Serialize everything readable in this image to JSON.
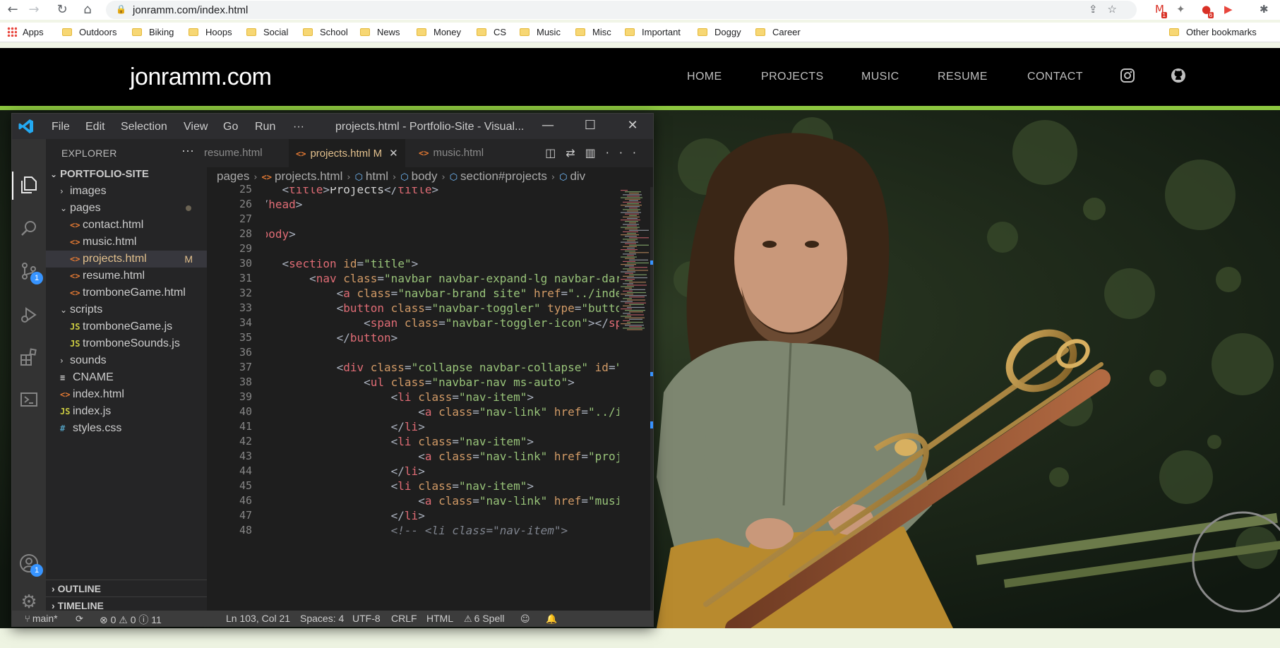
{
  "browser": {
    "url": "jonramm.com/index.html",
    "extensions": [
      {
        "name": "gmail-icon",
        "glyph": "M",
        "color": "#d93025",
        "badge": "1"
      },
      {
        "name": "dropbox-icon",
        "glyph": "✦",
        "color": "#7a7a7a",
        "badge": ""
      },
      {
        "name": "adblock-icon",
        "glyph": "●",
        "color": "#d93025",
        "badge": "6"
      },
      {
        "name": "cast-icon",
        "glyph": "▶",
        "color": "#e8453c",
        "badge": ""
      },
      {
        "name": "extension-bug-icon",
        "glyph": "✱",
        "color": "#5f6368",
        "badge": ""
      }
    ],
    "bookmarks": [
      "Apps",
      "Outdoors",
      "Biking",
      "Hoops",
      "Social",
      "School",
      "News",
      "Money",
      "CS",
      "Music",
      "Misc",
      "Important",
      "Doggy",
      "Career"
    ],
    "other_bookmarks": "Other bookmarks"
  },
  "site": {
    "brand": "jonramm.com",
    "nav": [
      "HOME",
      "PROJECTS",
      "MUSIC",
      "RESUME",
      "CONTACT"
    ],
    "accent": "#8cc63f"
  },
  "vscode": {
    "menu": [
      "File",
      "Edit",
      "Selection",
      "View",
      "Go",
      "Run",
      "···"
    ],
    "window_title": "projects.html - Portfolio-Site - Visual...",
    "explorer_title": "EXPLORER",
    "folder": "PORTFOLIO-SITE",
    "tree": [
      {
        "label": "images",
        "type": "folder",
        "open": false,
        "depth": 1
      },
      {
        "label": "pages",
        "type": "folder",
        "open": true,
        "depth": 1,
        "dot": true
      },
      {
        "label": "contact.html",
        "type": "html",
        "depth": 2
      },
      {
        "label": "music.html",
        "type": "html",
        "depth": 2
      },
      {
        "label": "projects.html",
        "type": "html",
        "depth": 2,
        "selected": true,
        "status": "M"
      },
      {
        "label": "resume.html",
        "type": "html",
        "depth": 2
      },
      {
        "label": "tromboneGame.html",
        "type": "html",
        "depth": 2
      },
      {
        "label": "scripts",
        "type": "folder",
        "open": true,
        "depth": 1
      },
      {
        "label": "tromboneGame.js",
        "type": "js",
        "depth": 2
      },
      {
        "label": "tromboneSounds.js",
        "type": "js",
        "depth": 2
      },
      {
        "label": "sounds",
        "type": "folder",
        "open": false,
        "depth": 1
      },
      {
        "label": "CNAME",
        "type": "cname",
        "depth": 1
      },
      {
        "label": "index.html",
        "type": "html",
        "depth": 1
      },
      {
        "label": "index.js",
        "type": "js",
        "depth": 1
      },
      {
        "label": "styles.css",
        "type": "css",
        "depth": 1
      }
    ],
    "outline": "OUTLINE",
    "timeline": "TIMELINE",
    "tabs": [
      {
        "label": "resume.html",
        "active": false
      },
      {
        "label": "projects.html",
        "active": true,
        "status": "M"
      },
      {
        "label": "music.html",
        "active": false
      }
    ],
    "breadcrumb": [
      "pages",
      "projects.html",
      "html",
      "body",
      "section#projects",
      "div"
    ],
    "first_line": 25,
    "code_lines": [
      "    <title>Projects</title>",
      "</head>",
      "",
      "<body>",
      "",
      "    <section id=\"title\">",
      "        <nav class=\"navbar navbar-expand-lg navbar-dark\">",
      "            <a class=\"navbar-brand site\" href=\"../index.html\">",
      "            <button class=\"navbar-toggler\" type=\"button\">",
      "                <span class=\"navbar-toggler-icon\"></span>",
      "            </button>",
      "",
      "            <div class=\"collapse navbar-collapse\" id=\"navbarNav\">",
      "                <ul class=\"navbar-nav ms-auto\">",
      "                    <li class=\"nav-item\">",
      "                        <a class=\"nav-link\" href=\"../index.html\">",
      "                    </li>",
      "                    <li class=\"nav-item\">",
      "                        <a class=\"nav-link\" href=\"projects.html\">",
      "                    </li>",
      "                    <li class=\"nav-item\">",
      "                        <a class=\"nav-link\" href=\"music.html\">",
      "                    </li>",
      "                    <!-- <li class=\"nav-item\">"
    ],
    "status": {
      "branch": "main*",
      "problems": "⊗ 0 ⚠ 0 ⓘ 11",
      "position": "Ln 103, Col 21",
      "spaces": "Spaces: 4",
      "encoding": "UTF-8",
      "eol": "CRLF",
      "language": "HTML",
      "spell": "6 Spell"
    },
    "badges": {
      "source_control": "1",
      "accounts": "1"
    }
  }
}
